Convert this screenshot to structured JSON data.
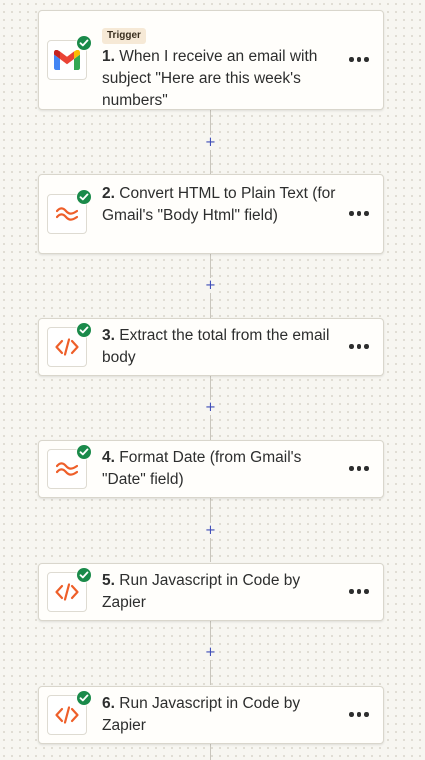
{
  "steps": [
    {
      "number": "1.",
      "badge": "Trigger",
      "text": "When I receive an email with subject \"Here are this week's numbers\"",
      "icon": "gmail-icon"
    },
    {
      "number": "2.",
      "text": "Convert HTML to Plain Text (for Gmail's \"Body Html\" field)",
      "icon": "formatter-icon"
    },
    {
      "number": "3.",
      "text": "Extract the total from the email body",
      "icon": "code-icon"
    },
    {
      "number": "4.",
      "text": "Format Date (from Gmail's \"Date\" field)",
      "icon": "formatter-icon"
    },
    {
      "number": "5.",
      "text": "Run Javascript in Code by Zapier",
      "icon": "code-icon"
    },
    {
      "number": "6.",
      "text": "Run Javascript in Code by Zapier",
      "icon": "code-icon"
    }
  ],
  "add_step_symbol": "+",
  "status": "success-check-icon",
  "more_menu": "more-options-icon",
  "colors": {
    "accent_orange": "#ee5f2a",
    "success_green": "#1a8a4a",
    "plus_blue": "#3e4db8",
    "gmail_red": "#ea4335",
    "gmail_blue": "#4285f4",
    "gmail_green": "#34a853",
    "gmail_yellow": "#fbbc04",
    "gmail_darkred": "#c5221f"
  }
}
